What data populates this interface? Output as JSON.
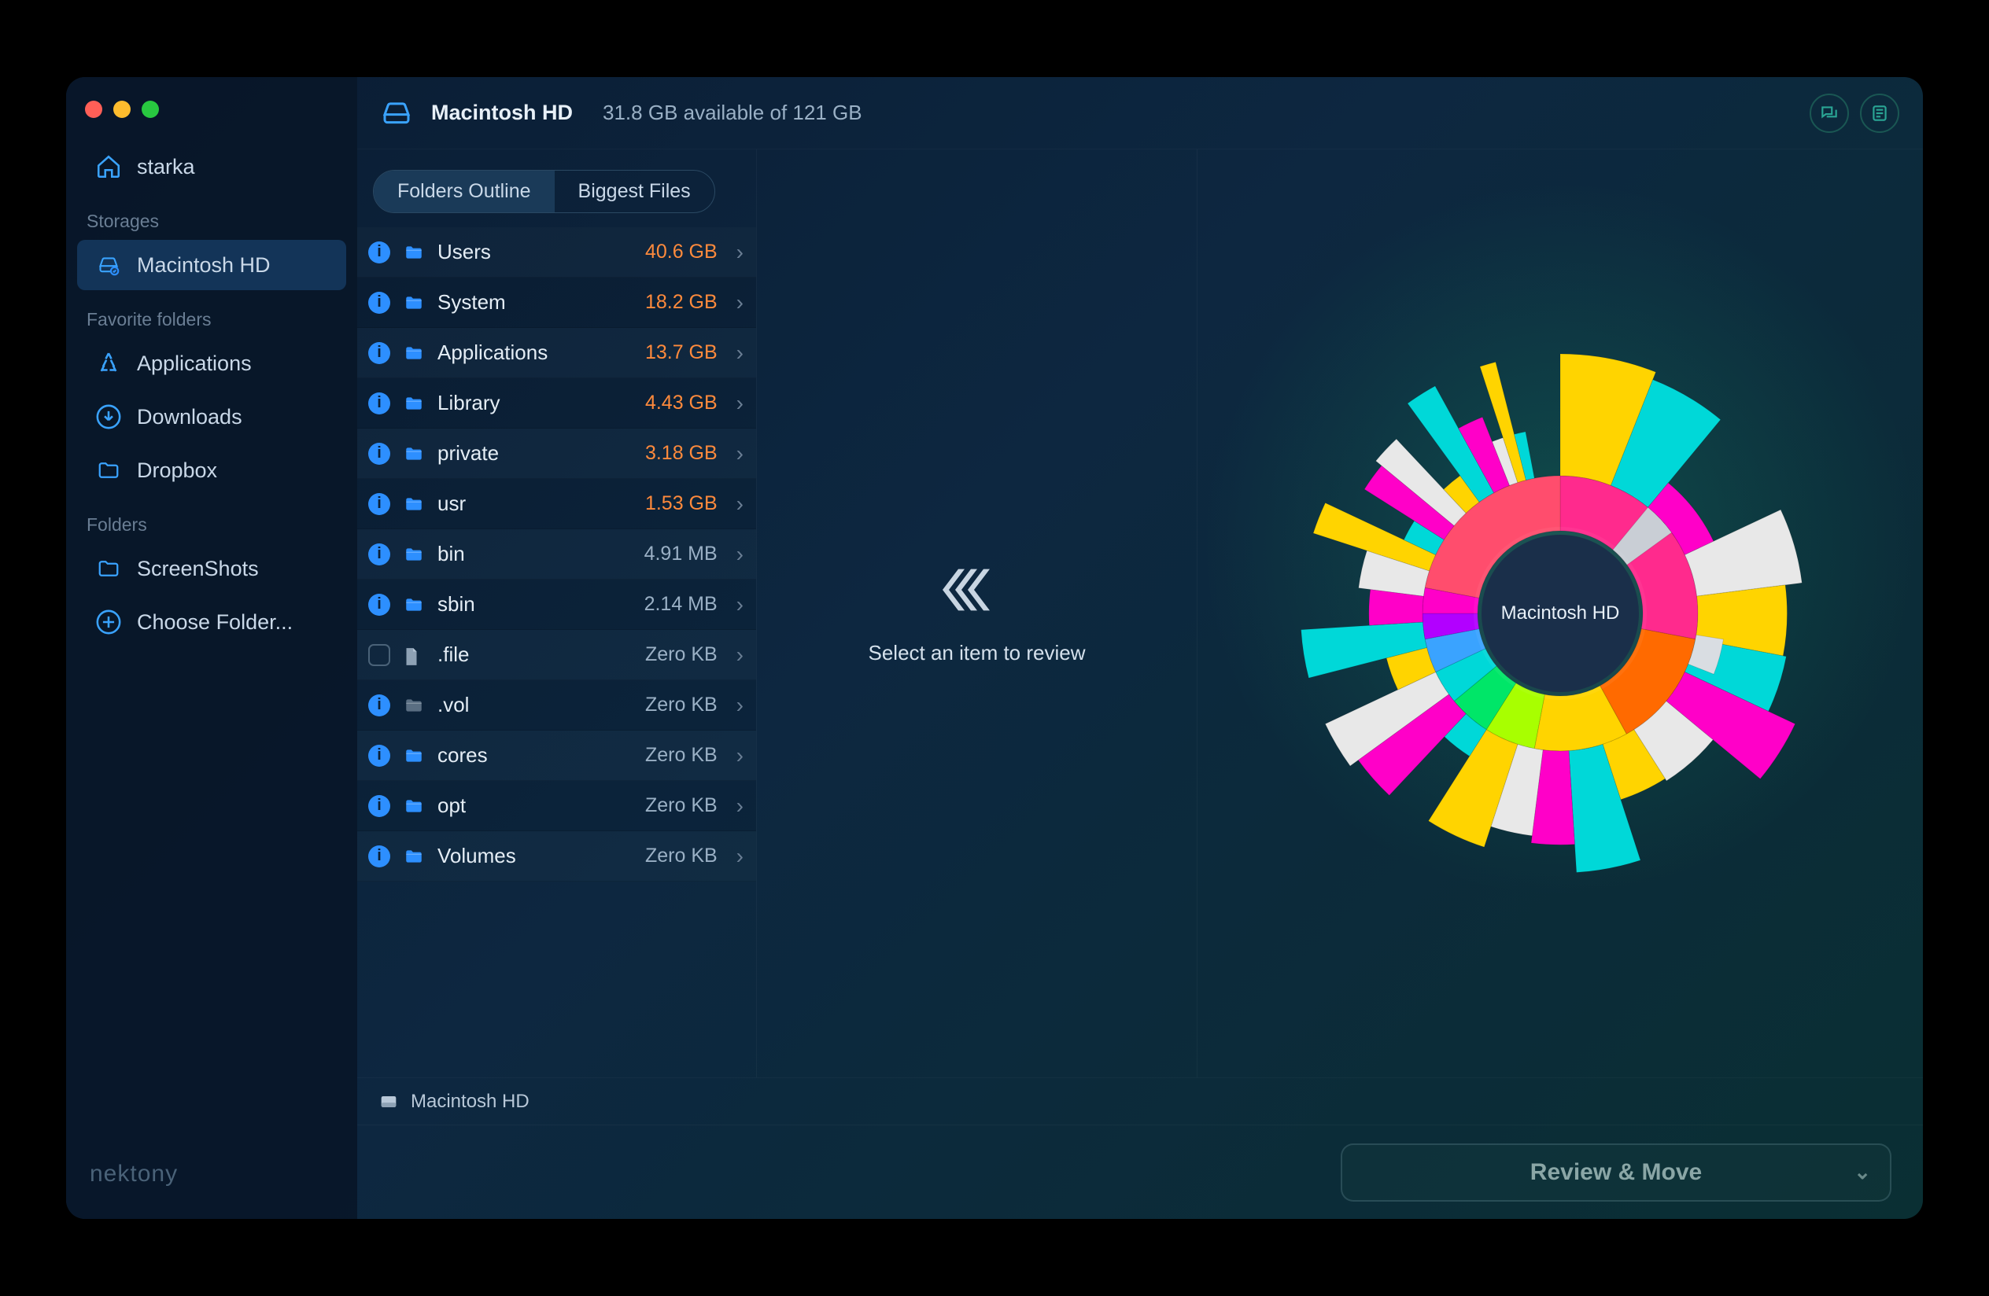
{
  "sidebar": {
    "home_label": "starka",
    "section_storages": "Storages",
    "storages": [
      {
        "label": "Macintosh HD",
        "active": true
      }
    ],
    "section_favorites": "Favorite folders",
    "favorites": [
      {
        "label": "Applications",
        "icon": "app-store"
      },
      {
        "label": "Downloads",
        "icon": "download"
      },
      {
        "label": "Dropbox",
        "icon": "folder"
      }
    ],
    "section_folders": "Folders",
    "folders": [
      {
        "label": "ScreenShots",
        "icon": "folder"
      },
      {
        "label": "Choose Folder...",
        "icon": "plus"
      }
    ],
    "brand": "nektony"
  },
  "header": {
    "disk_name": "Macintosh HD",
    "availability": "31.8 GB available of 121 GB"
  },
  "tabs": {
    "outline": "Folders Outline",
    "biggest": "Biggest Files"
  },
  "rows": [
    {
      "name": "Users",
      "size": "40.6 GB",
      "hot": true,
      "icon": "info",
      "type": "folder"
    },
    {
      "name": "System",
      "size": "18.2 GB",
      "hot": true,
      "icon": "info",
      "type": "folder"
    },
    {
      "name": "Applications",
      "size": "13.7 GB",
      "hot": true,
      "icon": "info",
      "type": "folder"
    },
    {
      "name": "Library",
      "size": "4.43 GB",
      "hot": true,
      "icon": "info",
      "type": "folder"
    },
    {
      "name": "private",
      "size": "3.18 GB",
      "hot": true,
      "icon": "info",
      "type": "folder"
    },
    {
      "name": "usr",
      "size": "1.53 GB",
      "hot": true,
      "icon": "info",
      "type": "folder"
    },
    {
      "name": "bin",
      "size": "4.91 MB",
      "hot": false,
      "icon": "info",
      "type": "folder"
    },
    {
      "name": "sbin",
      "size": "2.14 MB",
      "hot": false,
      "icon": "info",
      "type": "folder"
    },
    {
      "name": ".file",
      "size": "Zero KB",
      "hot": false,
      "icon": "check",
      "type": "file"
    },
    {
      "name": ".vol",
      "size": "Zero KB",
      "hot": false,
      "icon": "info",
      "type": "folder-dim"
    },
    {
      "name": "cores",
      "size": "Zero KB",
      "hot": false,
      "icon": "info",
      "type": "folder"
    },
    {
      "name": "opt",
      "size": "Zero KB",
      "hot": false,
      "icon": "info",
      "type": "folder"
    },
    {
      "name": "Volumes",
      "size": "Zero KB",
      "hot": false,
      "icon": "info",
      "type": "folder"
    }
  ],
  "mid": {
    "hint": "Select an item to review"
  },
  "sunburst": {
    "center_label": "Macintosh HD"
  },
  "path": {
    "label": "Macintosh HD"
  },
  "footer": {
    "button": "Review & Move"
  },
  "chart_data": {
    "type": "pie",
    "title": "Macintosh HD disk usage",
    "categories": [
      "Users",
      "System",
      "Applications",
      "Library",
      "private",
      "usr",
      "bin",
      "sbin",
      ".file",
      ".vol",
      "cores",
      "opt",
      "Volumes"
    ],
    "values_gb": [
      40.6,
      18.2,
      13.7,
      4.43,
      3.18,
      1.53,
      0.00491,
      0.00214,
      0,
      0,
      0,
      0,
      0
    ],
    "total_gb": 121,
    "available_gb": 31.8
  }
}
